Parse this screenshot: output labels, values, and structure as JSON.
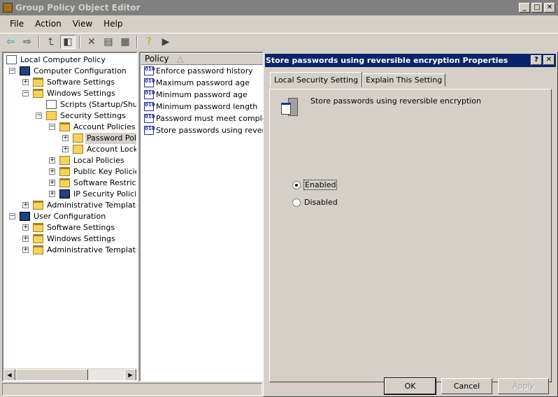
{
  "window": {
    "title": "Group Policy Object Editor",
    "controls": [
      "_",
      "□",
      "✕"
    ]
  },
  "menu": [
    {
      "label": "File"
    },
    {
      "label": "Action"
    },
    {
      "label": "View"
    },
    {
      "label": "Help"
    }
  ],
  "toolbar": [
    {
      "icon": "back-arrow-icon",
      "glyph": "⇦"
    },
    {
      "icon": "forward-arrow-icon",
      "glyph": "⇨"
    },
    {
      "sep": true
    },
    {
      "icon": "up-folder-icon",
      "glyph": "⮤"
    },
    {
      "icon": "show-hide-tree-icon",
      "glyph": "◧",
      "pressed": true
    },
    {
      "sep": true
    },
    {
      "icon": "delete-icon",
      "glyph": "✕"
    },
    {
      "icon": "properties-icon",
      "glyph": "▤"
    },
    {
      "icon": "export-list-icon",
      "glyph": "▦"
    },
    {
      "sep": true
    },
    {
      "icon": "help-icon",
      "glyph": "?"
    },
    {
      "icon": "show-action-pane-icon",
      "glyph": "▶"
    }
  ],
  "tree": [
    {
      "label": "Local Computer Policy",
      "level": 0,
      "icon": "doc",
      "exp": ""
    },
    {
      "label": "Computer Configuration",
      "level": 1,
      "icon": "comp",
      "exp": "-"
    },
    {
      "label": "Software Settings",
      "level": 2,
      "icon": "folder",
      "exp": "+"
    },
    {
      "label": "Windows Settings",
      "level": 2,
      "icon": "folder",
      "exp": "-"
    },
    {
      "label": "Scripts (Startup/Shutdo",
      "level": 3,
      "icon": "doc",
      "exp": ""
    },
    {
      "label": "Security Settings",
      "level": 3,
      "icon": "lockf",
      "exp": "-"
    },
    {
      "label": "Account Policies",
      "level": 4,
      "icon": "folder",
      "exp": "-"
    },
    {
      "label": "Password Polic",
      "level": 5,
      "icon": "lockf",
      "exp": "+",
      "selected": true
    },
    {
      "label": "Account Lockou",
      "level": 5,
      "icon": "lockf",
      "exp": "+"
    },
    {
      "label": "Local Policies",
      "level": 4,
      "icon": "lockf",
      "exp": "+"
    },
    {
      "label": "Public Key Policies",
      "level": 4,
      "icon": "folder",
      "exp": "+"
    },
    {
      "label": "Software Restrictic",
      "level": 4,
      "icon": "folder",
      "exp": "+"
    },
    {
      "label": "IP Security Policies",
      "level": 4,
      "icon": "comp",
      "exp": "+"
    },
    {
      "label": "Administrative Templates",
      "level": 2,
      "icon": "folder",
      "exp": "+"
    },
    {
      "label": "User Configuration",
      "level": 1,
      "icon": "comp",
      "exp": "-"
    },
    {
      "label": "Software Settings",
      "level": 2,
      "icon": "folder",
      "exp": "+"
    },
    {
      "label": "Windows Settings",
      "level": 2,
      "icon": "folder",
      "exp": "+"
    },
    {
      "label": "Administrative Templates",
      "level": 2,
      "icon": "folder",
      "exp": "+"
    }
  ],
  "list": {
    "column": "Policy",
    "sort_glyph": "△",
    "rows": [
      "Enforce password history",
      "Maximum password age",
      "Minimum password age",
      "Minimum password length",
      "Password must meet complexity",
      "Store passwords using reversibl"
    ]
  },
  "dialog": {
    "title": "Store passwords using reversible encryption Properties",
    "controls": [
      "?",
      "✕"
    ],
    "tabs": [
      "Local Security Setting",
      "Explain This Setting"
    ],
    "policy_name": "Store passwords using reversible encryption",
    "options": [
      {
        "label": "Enabled",
        "checked": true
      },
      {
        "label": "Disabled",
        "checked": false
      }
    ],
    "buttons": {
      "ok": "OK",
      "cancel": "Cancel",
      "apply": "Apply"
    }
  }
}
